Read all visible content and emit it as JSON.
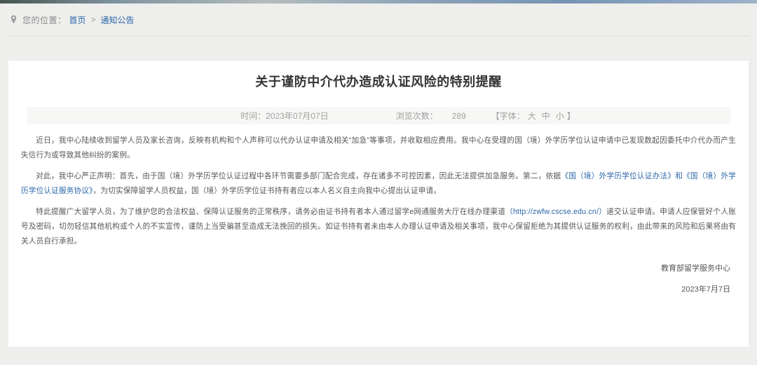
{
  "breadcrumb": {
    "location_label": "您的位置：",
    "home": "首页",
    "separator": ">",
    "section": "通知公告"
  },
  "article": {
    "title": "关于谨防中介代办造成认证风险的特别提醒",
    "meta": {
      "time_label": "时间：",
      "time_value": "2023年07月07日",
      "views_label": "浏览次数：",
      "views_value": "289",
      "font_prefix": "【字体：",
      "font_options": [
        "大",
        "中",
        "小"
      ],
      "font_suffix": "】"
    },
    "paragraphs": [
      {
        "segments": [
          {
            "text": "近日，我中心陆续收到留学人员及家长咨询，反映有机构和个人声称可以代办认证申请及相关“加急”等事项，并收取相应费用。我中心在受理的国（境）外学历学位认证申请中已发现数起因委托中介代办而产生失信行为或导致其他纠纷的案例。",
            "link": false
          }
        ]
      },
      {
        "segments": [
          {
            "text": "对此，我中心严正声明：首先，由于国（境）外学历学位认证过程中各环节需要多部门配合完成，存在诸多不可控因素，因此无法提供加急服务。第二，依据",
            "link": false
          },
          {
            "text": "《国（境）外学历学位认证办法》和《国（境）外学历学位认证服务协议》",
            "link": true
          },
          {
            "text": "，为切实保障留学人员权益，国（境）外学历学位证书持有者应以本人名义自主向我中心提出认证申请。",
            "link": false
          }
        ]
      },
      {
        "segments": [
          {
            "text": "特此提醒广大留学人员，为了维护您的合法权益、保障认证服务的正常秩序，请务必由证书持有者本人通过留学e网通服务大厅在线办理渠道",
            "link": false
          },
          {
            "text": "（http://zwfw.cscse.edu.cn/）",
            "link": true
          },
          {
            "text": "递交认证申请。申请人应保管好个人账号及密码，切勿轻信其他机构或个人的不实宣传，谨防上当受骗甚至造成无法挽回的损失。如证书持有者未由本人办理认证申请及相关事项，我中心保留拒绝为其提供认证服务的权利，由此带来的风险和后果将由有关人员自行承担。",
            "link": false
          }
        ]
      }
    ],
    "signature": "教育部留学服务中心",
    "date": "2023年7月7日"
  },
  "colors": {
    "link": "#2b66a8",
    "body_text": "#565656",
    "title_text": "#333333",
    "meta_text": "#a0a0a0",
    "page_bg": "#eeeeec",
    "card_bg": "#ffffff"
  }
}
